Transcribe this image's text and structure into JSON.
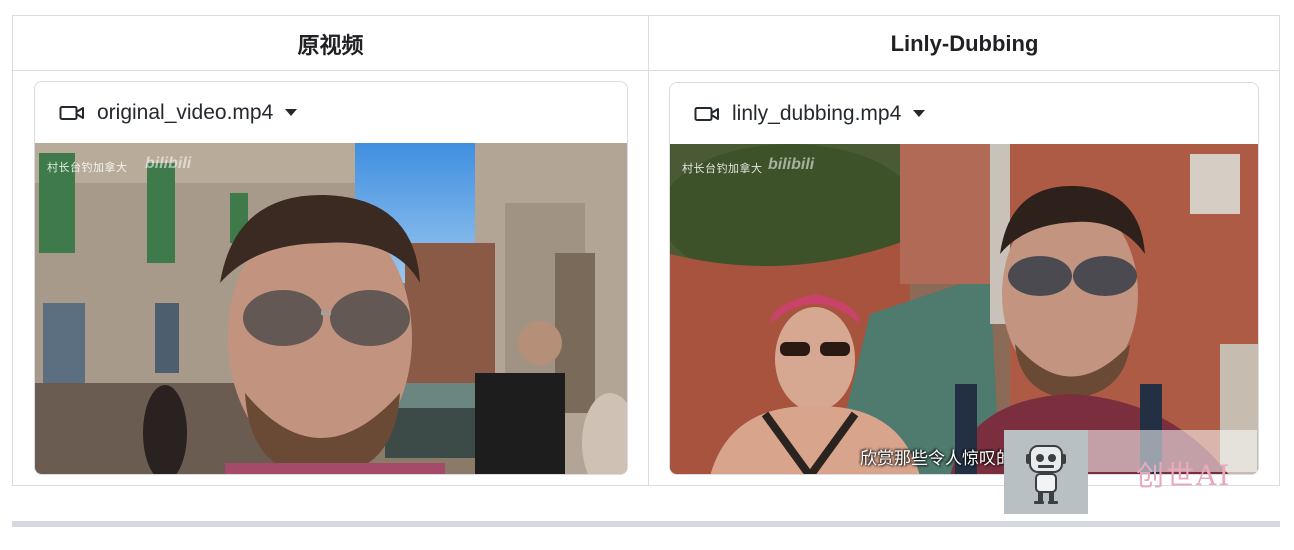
{
  "table": {
    "headers": {
      "left": "原视频",
      "right": "Linly-Dubbing"
    }
  },
  "videos": [
    {
      "filename": "original_video.mp4",
      "watermark_channel": "村长台钓加拿大",
      "watermark_site": "bilibili"
    },
    {
      "filename": "linly_dubbing.mp4",
      "watermark_channel": "村长台钓加拿大",
      "watermark_site": "bilibili",
      "subtitle": "欣赏那些令人惊叹的街"
    }
  ],
  "overlay": {
    "logo_text": "创世AI",
    "icon": "robot-icon"
  },
  "icons": {
    "camera": "video-camera-icon",
    "dropdown": "caret-down-icon"
  },
  "colors": {
    "border": "#d9dde3",
    "bottom_bar": "#d4d8e1",
    "logo_text": "#e8a9be"
  }
}
